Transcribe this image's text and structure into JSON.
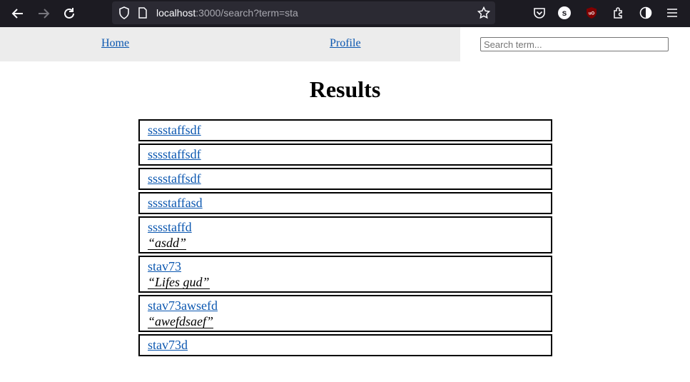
{
  "browser": {
    "url_host": "localhost",
    "url_rest": ":3000/search?term=sta",
    "extension_letter": "s"
  },
  "nav": {
    "home": "Home",
    "profile": "Profile",
    "search_placeholder": "Search term..."
  },
  "page": {
    "title": "Results"
  },
  "results": [
    {
      "name": "sssstaffsdf",
      "quote": ""
    },
    {
      "name": "sssstaffsdf",
      "quote": ""
    },
    {
      "name": "sssstaffsdf",
      "quote": ""
    },
    {
      "name": "sssstaffasd",
      "quote": ""
    },
    {
      "name": "sssstaffd",
      "quote": "“asdd”"
    },
    {
      "name": "stav73",
      "quote": "“Lifes gud”"
    },
    {
      "name": "stav73awsefd",
      "quote": "“awefdsaef”"
    },
    {
      "name": "stav73d",
      "quote": ""
    }
  ]
}
